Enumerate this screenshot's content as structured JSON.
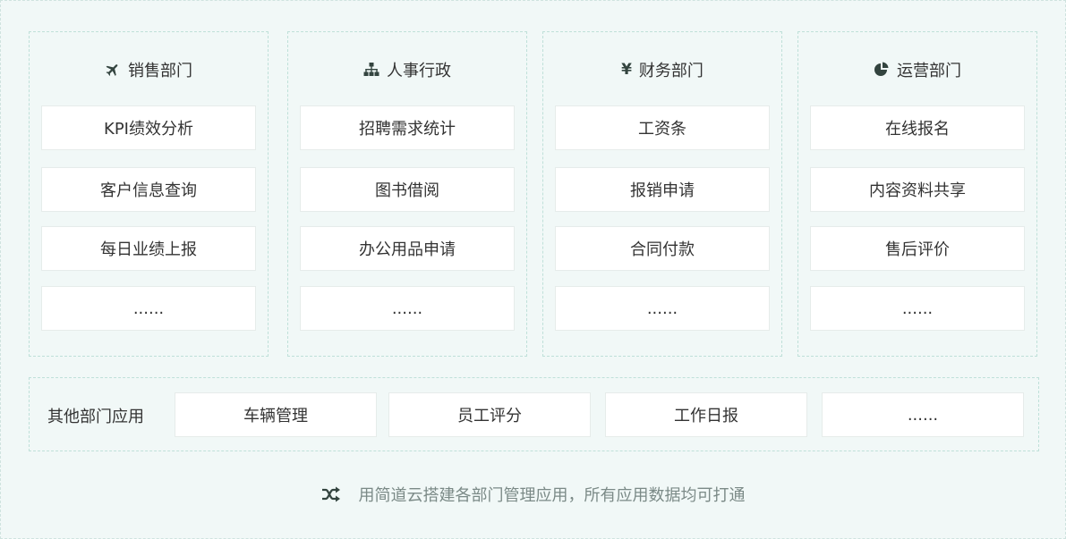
{
  "departments": [
    {
      "name": "销售部门",
      "icon": "airplane-icon",
      "apps": [
        "KPI绩效分析",
        "客户信息查询",
        "每日业绩上报",
        "......"
      ]
    },
    {
      "name": "人事行政",
      "icon": "org-chart-icon",
      "apps": [
        "招聘需求统计",
        "图书借阅",
        "办公用品申请",
        "......"
      ]
    },
    {
      "name": "财务部门",
      "icon": "yen-icon",
      "icon_glyph": "¥",
      "apps": [
        "工资条",
        "报销申请",
        "合同付款",
        "......"
      ]
    },
    {
      "name": "运营部门",
      "icon": "pie-chart-icon",
      "apps": [
        "在线报名",
        "内容资料共享",
        "售后评价",
        "......"
      ]
    }
  ],
  "other": {
    "title": "其他部门应用",
    "apps": [
      "车辆管理",
      "员工评分",
      "工作日报",
      "......"
    ]
  },
  "footer": {
    "icon": "shuffle-icon",
    "text": "用简道云搭建各部门管理应用，所有应用数据均可打通"
  },
  "colors": {
    "background": "#f1f8f7",
    "dashed_border": "#bfe0d9",
    "card_background": "#ffffff",
    "card_border": "#e6ecea",
    "text": "#333333",
    "icon": "#33443f",
    "footer_text": "#7b8a87"
  }
}
